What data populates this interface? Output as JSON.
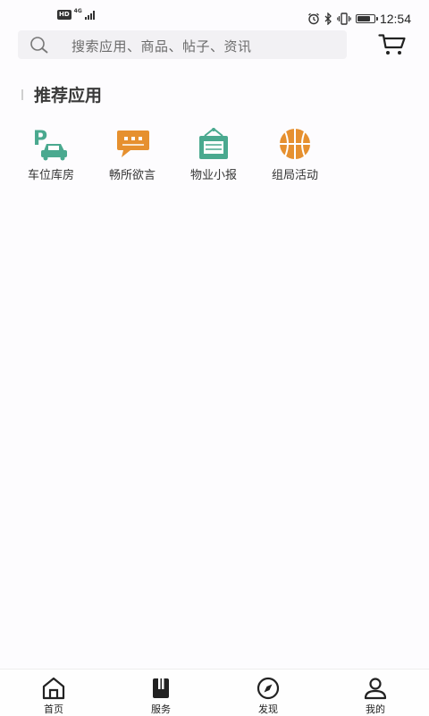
{
  "status_bar": {
    "hd_badge": "HD",
    "network": "4G",
    "time": "12:54",
    "battery_level": 0.85,
    "icons": [
      "alarm-icon",
      "bluetooth-icon",
      "vibrate-icon",
      "battery-icon"
    ]
  },
  "search": {
    "placeholder": "搜索应用、商品、帖子、资讯",
    "icon": "search-icon"
  },
  "header": {
    "cart_icon": "cart-icon"
  },
  "section": {
    "title": "推荐应用"
  },
  "apps": [
    {
      "label": "车位库房",
      "icon": "parking-car-icon",
      "color": "#4aa98f"
    },
    {
      "label": "畅所欲言",
      "icon": "chat-bubble-icon",
      "color": "#e6902f"
    },
    {
      "label": "物业小报",
      "icon": "notice-board-icon",
      "color": "#4aa98f"
    },
    {
      "label": "组局活动",
      "icon": "basketball-icon",
      "color": "#e6902f"
    }
  ],
  "bottom_nav": [
    {
      "label": "首页",
      "icon": "home-icon"
    },
    {
      "label": "服务",
      "icon": "service-book-icon"
    },
    {
      "label": "发现",
      "icon": "compass-icon"
    },
    {
      "label": "我的",
      "icon": "user-icon"
    }
  ]
}
